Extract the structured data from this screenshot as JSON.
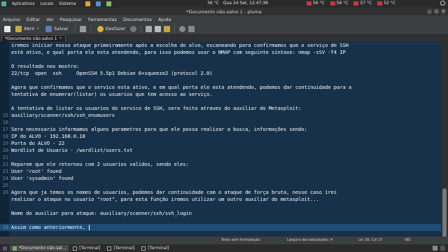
{
  "top_panel": {
    "menu": [
      "Aplicativos",
      "Locais",
      "Sistema"
    ],
    "temps": [
      "36 °C",
      "56 °C",
      "56 °C",
      "57 °C",
      "52 °C"
    ],
    "datetime": "Qua 24 Set, 12:47:36",
    "colors": {
      "sys_icon_1": "#e2a23b",
      "sys_icon_2": "#4a90d9",
      "sys_icon_3": "#7fbf5f"
    }
  },
  "window": {
    "title": "*Documento não-salvo 1 - pluma",
    "controls": [
      "_",
      "□",
      "×"
    ]
  },
  "menubar": [
    "Arquivo",
    "Editar",
    "Ver",
    "Pesquisar",
    "Ferramentas",
    "Documentos",
    "Ajuda"
  ],
  "toolbar": {
    "open_label": "Abrir",
    "save_label": "Salvar",
    "undo_label": "Desfazer",
    "icons": [
      "new-document-icon",
      "open-folder-icon",
      "save-icon",
      "print-icon",
      "undo-icon",
      "redo-icon",
      "cut-icon",
      "copy-icon",
      "paste-icon",
      "search-icon",
      "replace-icon"
    ]
  },
  "tab": {
    "label": "*Documento não-salvo 1",
    "close": "×"
  },
  "editor": {
    "colors": {
      "background": "#17314a",
      "text": "#ffffff",
      "current_line": "#1f4d74"
    },
    "lines": [
      {
        "num": "",
        "text": "iremos iniciar nosso ataque primeiramente após a escolha do alvo, escaneando para confirmamos que o serviço de SSH"
      },
      {
        "num": "",
        "text": "está ativo, e qual porta ele esta atendendo, para isso podemos usar o NMAP com seguinte sintaxe: nmap -sSV -T4 IP"
      },
      {
        "num": "",
        "text": ""
      },
      {
        "num": "",
        "text": "O resultado nos mostra:"
      },
      {
        "num": "",
        "text": "22/tcp  open  ssh     OpenSSH 5.5p1 Debian 6+squeeze2 (protocol 2.0)"
      },
      {
        "num": "",
        "text": ""
      },
      {
        "num": "",
        "text": "Agora que confirmamos que o servico esta ativo, e em qual porta ele esta atendendo, podemos dar continuidade para a"
      },
      {
        "num": "",
        "text": "tentativa de enumerar(listar) os usuarios que tem acesso ao serviço."
      },
      {
        "num": "",
        "text": ""
      },
      {
        "num": "",
        "text": "A tentativa de listar os usuarios do servico de SSH, sera feito atraves do auxiliar do Metasploit:"
      },
      {
        "num": "",
        "text": "auxiliary/scanner/ssh/ssh_enumusers"
      },
      {
        "num": "",
        "text": ""
      },
      {
        "num": "",
        "text": "Sera necessario informamos alguns parametros para que ele possa realizar a busca, informações sendo:"
      },
      {
        "num": "",
        "text": "IP do ALVO - 192.168.0.18"
      },
      {
        "num": "",
        "text": "Porta do ALVO - 22"
      },
      {
        "num": "",
        "text": "Wordlist de Usuario - /wordlist/users.txt"
      },
      {
        "num": "",
        "text": ""
      },
      {
        "num": "",
        "text": "Reparem que ele retornou com 2 usuarios validos, sendo eles:"
      },
      {
        "num": "",
        "text": "User 'root' found"
      },
      {
        "num": "",
        "text": "User 'sysadmin' found"
      },
      {
        "num": "",
        "text": ""
      },
      {
        "num": "",
        "text": "Agora que ja temos os nomes de usuarios, podemos dar continuidade com o ataque de força bruta, nesse caso irei"
      },
      {
        "num": "",
        "text": "realizar o ataque no usuario \"root\", para esta função iremos utilizar um outro auxiliar do metasploit..."
      },
      {
        "num": "",
        "text": ""
      },
      {
        "num": "",
        "text": "Nome do auxiliar para ataque: auxiliary/scanner/ssh/ssh_login"
      },
      {
        "num": "",
        "text": ""
      },
      {
        "num": "",
        "text": "Assim como anteriormente, "
      }
    ],
    "line_numbers": [
      "",
      "",
      "",
      "",
      "",
      "",
      "",
      "",
      "",
      "",
      "15",
      "16",
      "17",
      "18",
      "19",
      "20",
      "21",
      "22",
      "23",
      "24",
      "25",
      "26",
      "",
      "",
      "",
      "",
      "28"
    ],
    "scroll_position": 0.8
  },
  "statusbar": {
    "format": "Texto sem formatação",
    "tab_width": "Largura das tabulações: 4",
    "position": "Lin 28, Col 27",
    "mode": "INS"
  },
  "bottom_panel": {
    "tasks": [
      {
        "label": "*Documento não-sal...",
        "active": true,
        "kind": "editor"
      },
      {
        "label": "[Terminal]",
        "active": false,
        "kind": "term"
      },
      {
        "label": "[Terminal]",
        "active": false,
        "kind": "term"
      },
      {
        "label": "[Terminal]",
        "active": false,
        "kind": "term"
      }
    ]
  }
}
